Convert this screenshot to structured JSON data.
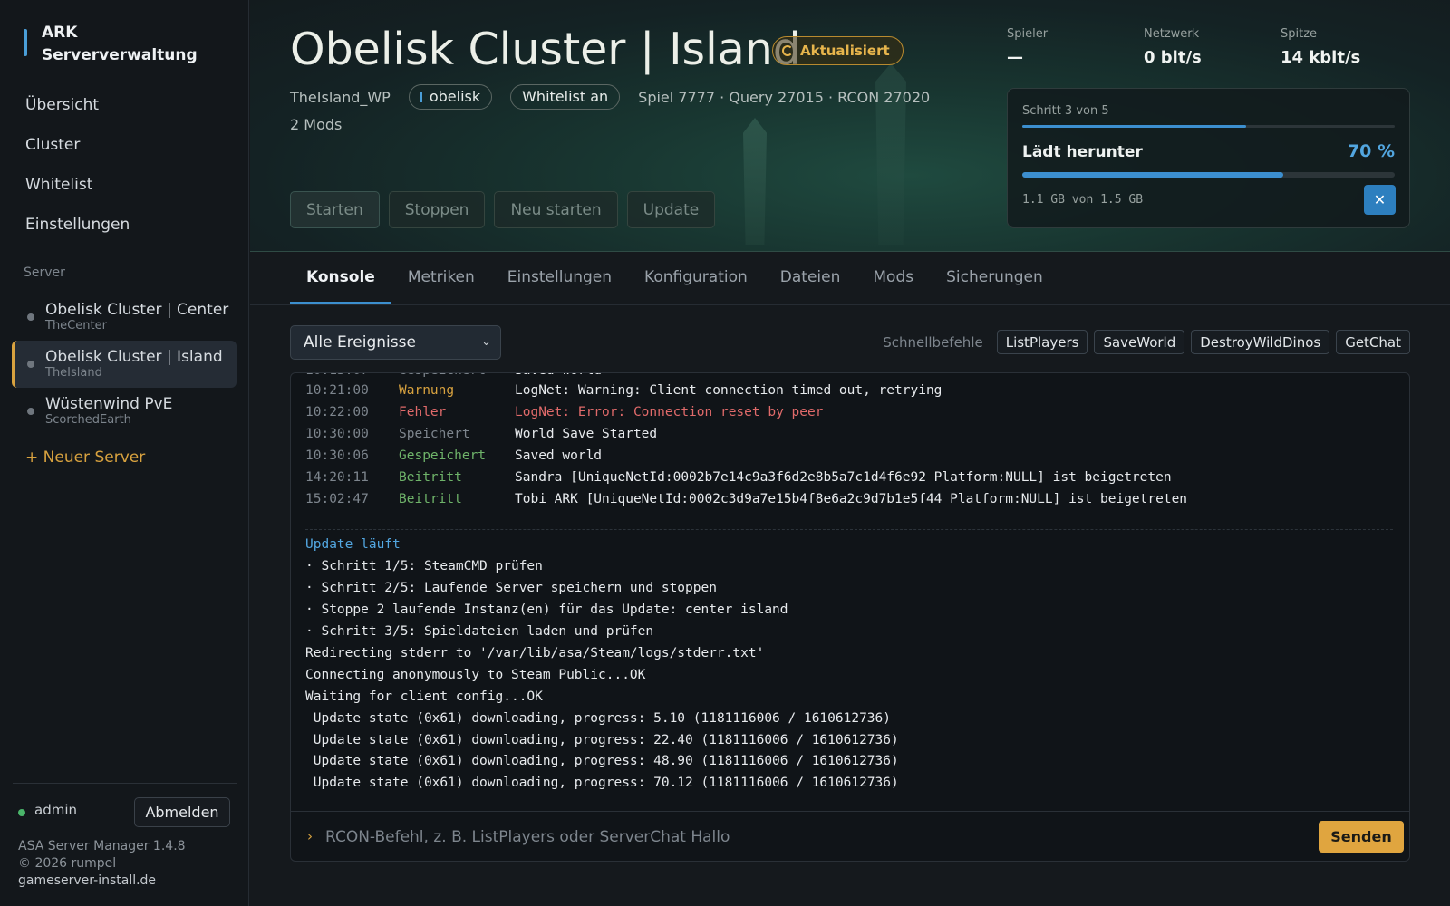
{
  "brand": {
    "line1": "ARK",
    "line2": "Serververwaltung"
  },
  "nav": [
    {
      "label": "Übersicht"
    },
    {
      "label": "Cluster"
    },
    {
      "label": "Whitelist"
    },
    {
      "label": "Einstellungen"
    }
  ],
  "sidebar": {
    "section_label": "Server",
    "servers": [
      {
        "name": "Obelisk Cluster | Center",
        "map": "TheCenter",
        "active": false
      },
      {
        "name": "Obelisk Cluster | Island",
        "map": "TheIsland",
        "active": true
      },
      {
        "name": "Wüstenwind PvE",
        "map": "ScorchedEarth",
        "active": false
      }
    ],
    "new_server": "+ Neuer Server",
    "user": "admin",
    "logout": "Abmelden",
    "version": "ASA Server Manager 1.4.8",
    "copyright": "© 2026 rumpel",
    "site": "gameserver-install.de"
  },
  "hero": {
    "title": "Obelisk Cluster | Island",
    "status": "Aktualisiert",
    "map_id": "TheIsland_WP",
    "cluster_chip": "obelisk",
    "whitelist_chip": "Whitelist an",
    "ports": "Spiel 7777 · Query 27015 · RCON 27020",
    "mods": "2 Mods",
    "actions": {
      "start": "Starten",
      "stop": "Stoppen",
      "restart": "Neu starten",
      "update": "Update"
    }
  },
  "stats": [
    {
      "label": "Spieler",
      "value": "—"
    },
    {
      "label": "Netzwerk",
      "value": "0 bit/s"
    },
    {
      "label": "Spitze",
      "value": "14 kbit/s"
    }
  ],
  "progress": {
    "step_label": "Schritt 3 von 5",
    "step_fraction": 0.6,
    "phase": "Lädt herunter",
    "percent_label": "70 %",
    "percent": 0.7,
    "size": "1.1 GB von 1.5 GB",
    "cancel": "✕"
  },
  "tabs": [
    "Konsole",
    "Metriken",
    "Einstellungen",
    "Konfiguration",
    "Dateien",
    "Mods",
    "Sicherungen"
  ],
  "filter": {
    "value": "Alle Ereignisse",
    "chevron": "⌄"
  },
  "quick": {
    "label": "Schnellbefehle",
    "commands": [
      "ListPlayers",
      "SaveWorld",
      "DestroyWildDinos",
      "GetChat"
    ]
  },
  "log": [
    {
      "time": "10:21:00",
      "kind": "Warnung",
      "type": "warn",
      "msg": "LogNet: Warning: Client connection timed out, retrying"
    },
    {
      "time": "10:22:00",
      "kind": "Fehler",
      "type": "err",
      "msg": "LogNet: Error: Connection reset by peer"
    },
    {
      "time": "10:30:00",
      "kind": "Speichert",
      "type": "save",
      "msg": "World Save Started"
    },
    {
      "time": "10:30:06",
      "kind": "Gespeichert",
      "type": "ok",
      "msg": "Saved world"
    },
    {
      "time": "14:20:11",
      "kind": "Beitritt",
      "type": "ok",
      "msg": "Sandra [UniqueNetId:0002b7e14c9a3f6d2e8b5a7c1d4f6e92 Platform:NULL] ist beigetreten"
    },
    {
      "time": "15:02:47",
      "kind": "Beitritt",
      "type": "ok",
      "msg": "Tobi_ARK [UniqueNetId:0002c3d9a7e15b4f8e6a2c9d7b1e5f44 Platform:NULL] ist beigetreten"
    }
  ],
  "update_output": {
    "title": "Update läuft",
    "lines": [
      "· Schritt 1/5: SteamCMD prüfen",
      "· Schritt 2/5: Laufende Server speichern und stoppen",
      "· Stoppe 2 laufende Instanz(en) für das Update: center island",
      "· Schritt 3/5: Spieldateien laden und prüfen",
      "Redirecting stderr to '/var/lib/asa/Steam/logs/stderr.txt'",
      "Connecting anonymously to Steam Public...OK",
      "Waiting for client config...OK",
      " Update state (0x61) downloading, progress: 5.10 (1181116006 / 1610612736)",
      " Update state (0x61) downloading, progress: 22.40 (1181116006 / 1610612736)",
      " Update state (0x61) downloading, progress: 48.90 (1181116006 / 1610612736)",
      " Update state (0x61) downloading, progress: 70.12 (1181116006 / 1610612736)"
    ]
  },
  "rcon": {
    "prompt": "›",
    "placeholder": "RCON-Befehl, z. B. ListPlayers oder ServerChat Hallo",
    "send": "Senden"
  },
  "colors": {
    "accent": "#3c8fcf",
    "gold": "#d8a23f",
    "error": "#e06a6a",
    "success": "#6fb46a"
  }
}
